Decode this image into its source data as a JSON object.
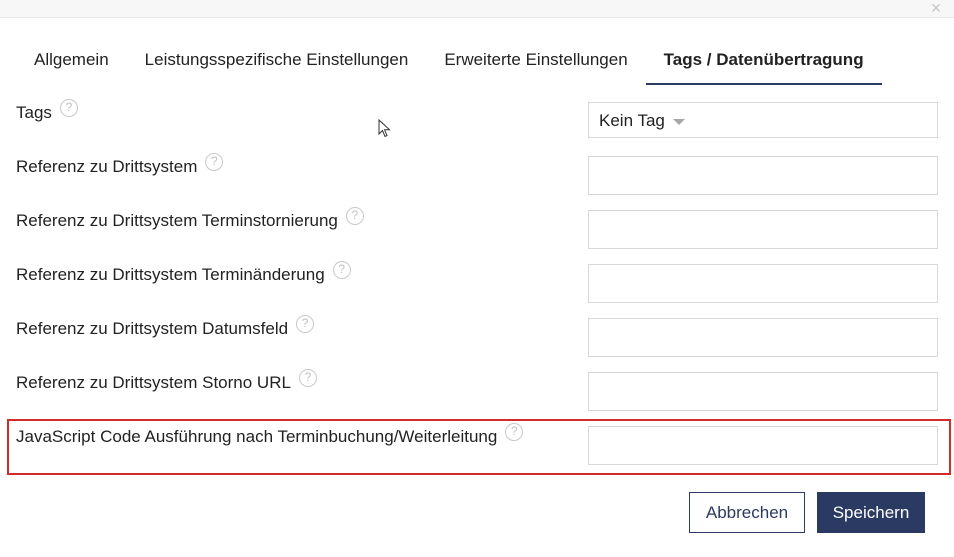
{
  "dialog": {
    "close_icon": "close-icon"
  },
  "tabs": [
    {
      "label": "Allgemein"
    },
    {
      "label": "Leistungsspezifische Einstellungen"
    },
    {
      "label": "Erweiterte Einstellungen"
    },
    {
      "label": "Tags / Datenübertragung",
      "active": true
    }
  ],
  "fields": {
    "tags": {
      "label": "Tags",
      "value": "Kein Tag"
    },
    "ref_third_party": {
      "label": "Referenz zu Drittsystem",
      "value": ""
    },
    "ref_cancellation": {
      "label": "Referenz zu Drittsystem Terminstornierung",
      "value": ""
    },
    "ref_change": {
      "label": "Referenz zu Drittsystem Terminänderung",
      "value": ""
    },
    "ref_date": {
      "label": "Referenz zu Drittsystem Datumsfeld",
      "value": ""
    },
    "ref_storno_url": {
      "label": "Referenz zu Drittsystem Storno URL",
      "value": ""
    },
    "js_code": {
      "label": "JavaScript Code Ausführung nach Terminbuchung/Weiterleitung",
      "value": ""
    }
  },
  "help_glyph": "?",
  "buttons": {
    "cancel": "Abbrechen",
    "save": "Speichern"
  },
  "colors": {
    "accent": "#2b3a62",
    "highlight": "#d42a2a"
  }
}
